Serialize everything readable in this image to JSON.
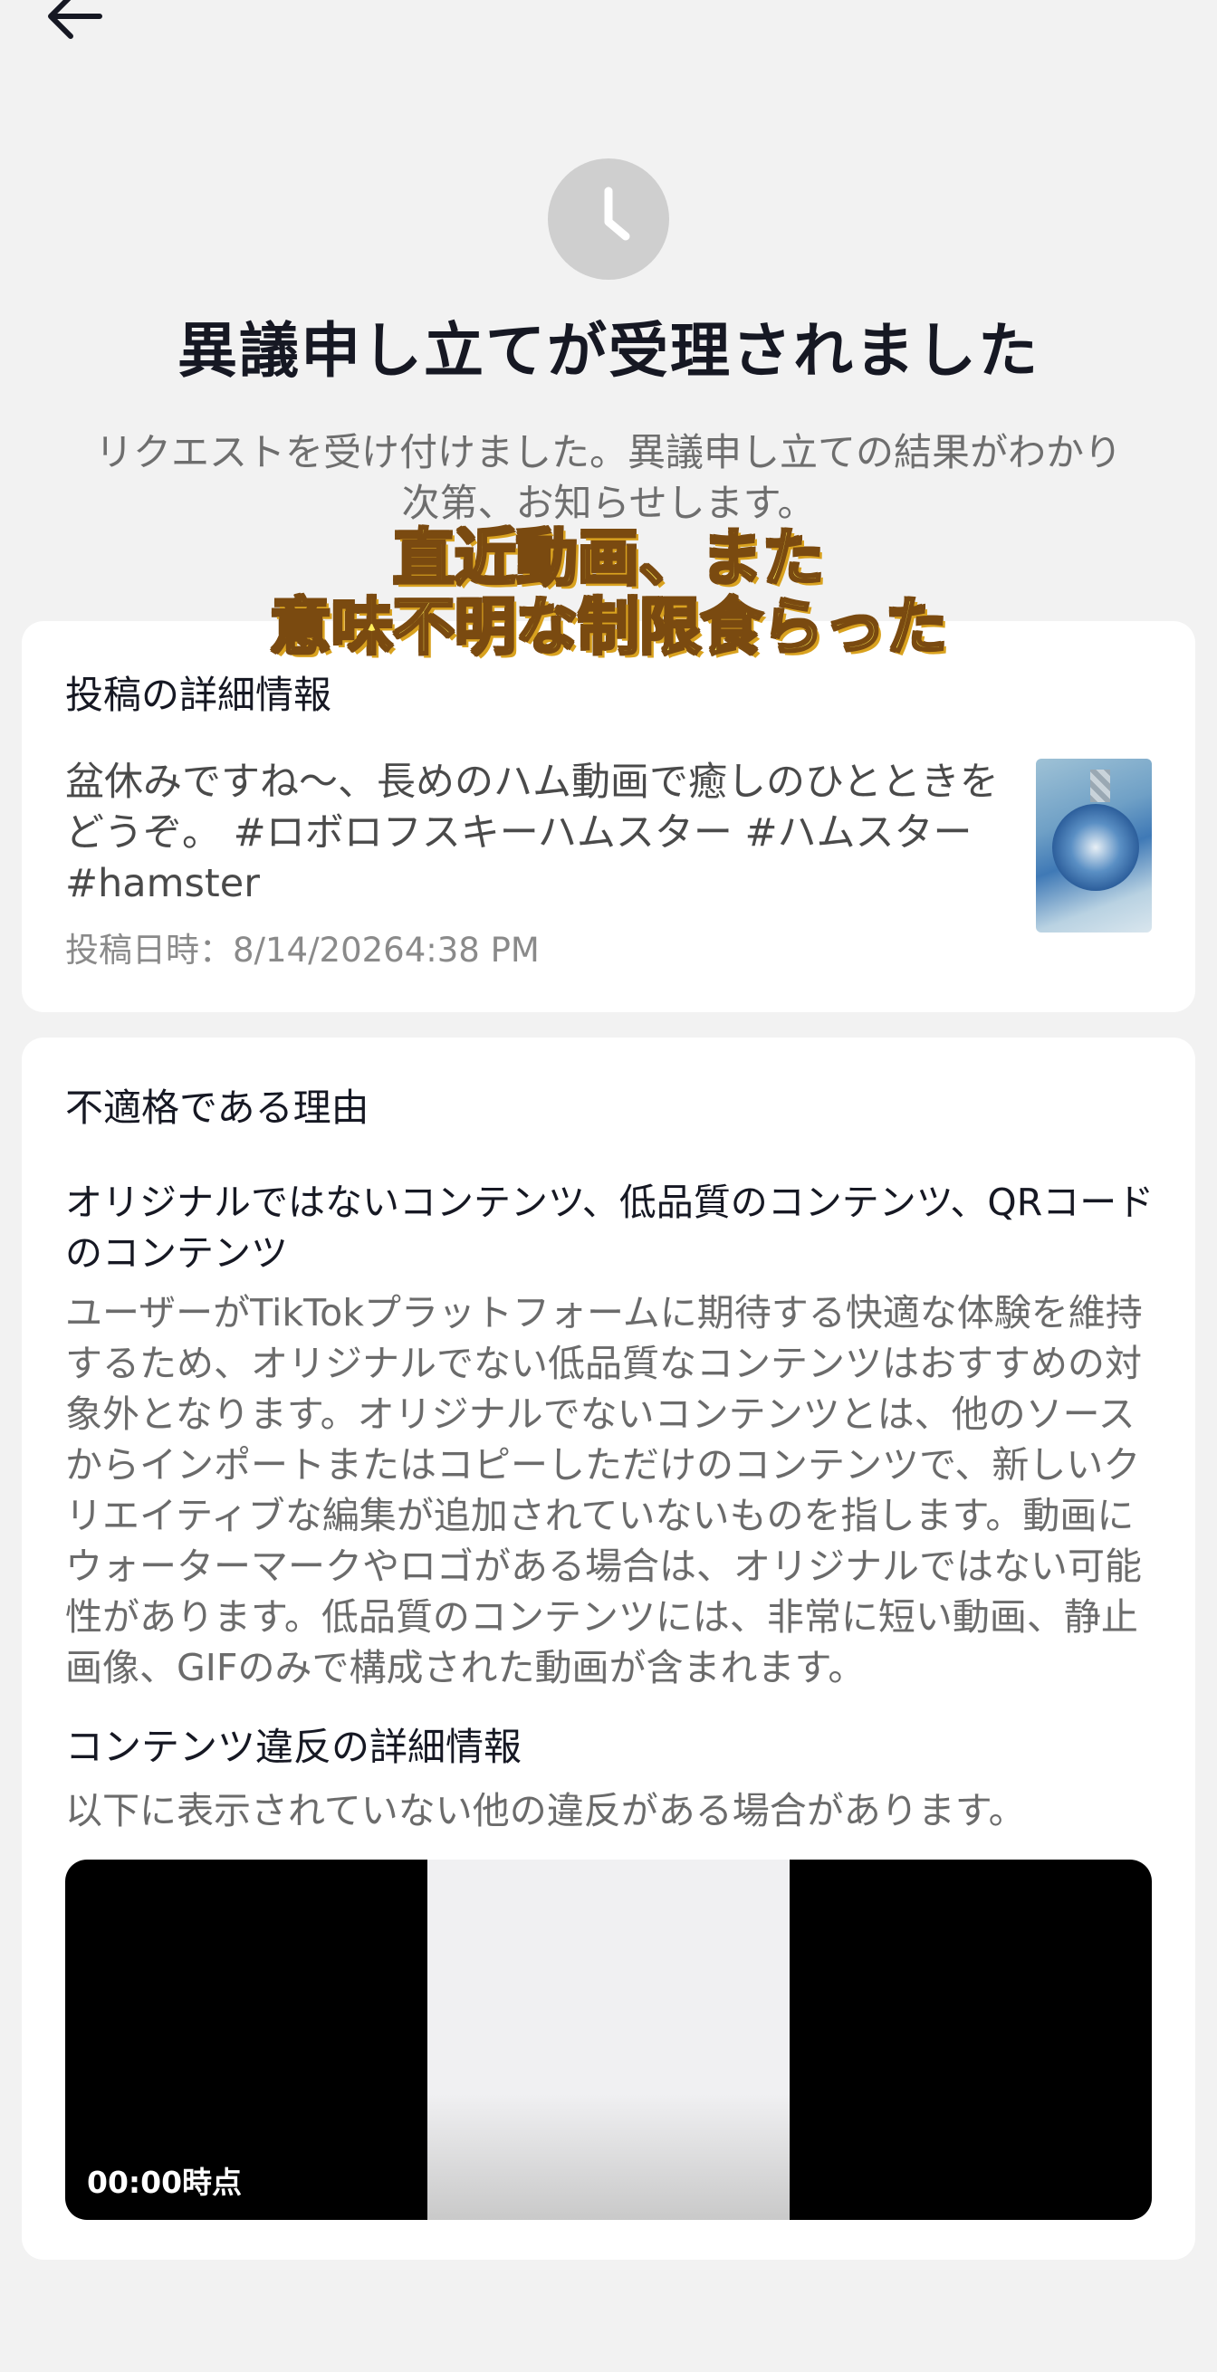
{
  "nav": {
    "back_icon": "arrow-left-icon"
  },
  "status": {
    "icon": "clock-icon",
    "title": "異議申し立てが受理されました",
    "subtitle": "リクエストを受け付けました。異議申し立ての結果がわかり次第、お知らせします。"
  },
  "overlay_caption": {
    "line1": "直近動画、また",
    "line2": "意味不明な制限食らった"
  },
  "post": {
    "heading": "投稿の詳細情報",
    "description": "盆休みですね〜、長めのハム動画で癒しのひとときをどうぞ。 #ロボロフスキーハムスター  #ハムスター #hamster",
    "date": "投稿日時：8/14/20264:38 PM"
  },
  "reason": {
    "heading": "不適格である理由",
    "category": "オリジナルではないコンテンツ、低品質のコンテンツ、QRコードのコンテンツ",
    "body": "ユーザーがTikTokプラットフォームに期待する快適な体験を維持するため、オリジナルでない低品質なコンテンツはおすすめの対象外となります。オリジナルでないコンテンツとは、他のソースからインポートまたはコピーしただけのコンテンツで、新しいクリエイティブな編集が追加されていないものを指します。動画にウォーターマークやロゴがある場合は、オリジナルではない可能性があります。低品質のコンテンツには、非常に短い動画、静止画像、GIFのみで構成された動画が含まれます。",
    "violation_heading": "コンテンツ違反の詳細情報",
    "violation_note": "以下に表示されていない他の違反がある場合があります。",
    "video_timestamp": "00:00時点"
  }
}
